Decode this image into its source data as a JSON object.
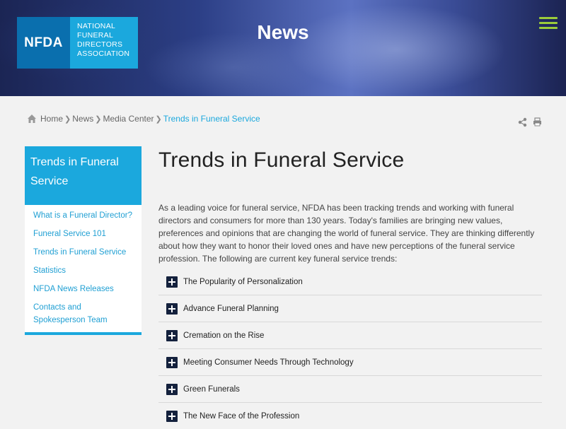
{
  "header": {
    "logo_abbr": "NFDA",
    "logo_lines": [
      "NATIONAL",
      "FUNERAL",
      "DIRECTORS",
      "ASSOCIATION"
    ],
    "title": "News",
    "menu_icon": "hamburger-menu-icon",
    "menu_color": "#9bcc3a"
  },
  "breadcrumb": {
    "items": [
      "Home",
      "News",
      "Media Center"
    ],
    "current": "Trends in Funeral Service"
  },
  "tools": {
    "share_icon": "share-icon",
    "print_icon": "print-icon"
  },
  "sidebar": {
    "title": "Trends in Funeral Service",
    "items": [
      "What is a Funeral Director?",
      "Funeral Service 101",
      "Trends in Funeral Service",
      "Statistics",
      "NFDA News Releases",
      "Contacts and Spokesperson Team"
    ]
  },
  "main": {
    "title": "Trends in Funeral Service",
    "intro": "As a leading voice for funeral service, NFDA has been tracking trends and working with funeral directors and consumers for more than 130 years. Today's families are bringing new values, preferences and opinions that are changing the world of funeral service. They are thinking differently about how they want to honor their loved ones and have new perceptions of the funeral service profession. The following are current key funeral service trends:",
    "accordion": [
      "The Popularity of Personalization",
      "Advance Funeral Planning",
      "Cremation on the Rise",
      "Meeting Consumer Needs Through Technology",
      "Green Funerals",
      "The New Face of the Profession"
    ]
  },
  "colors": {
    "accent": "#1ba8dd",
    "logo_dark": "#0a6fae",
    "accordion_icon": "#14213d"
  }
}
